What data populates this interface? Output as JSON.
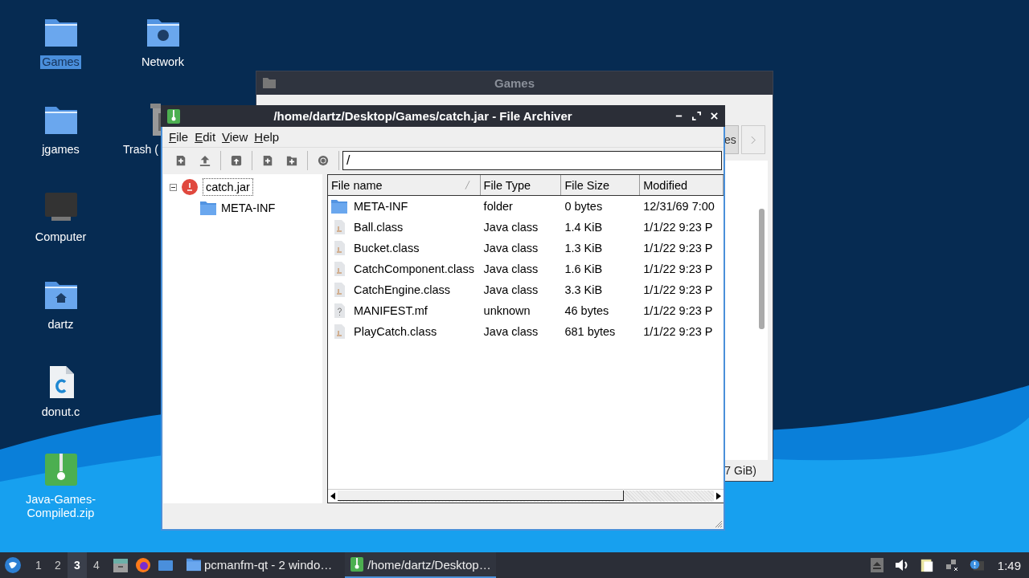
{
  "desktop": {
    "icons": [
      {
        "label": "Games",
        "kind": "folder",
        "selected": true
      },
      {
        "label": "jgames",
        "kind": "folder",
        "selected": false
      },
      {
        "label": "Computer",
        "kind": "computer",
        "selected": false
      },
      {
        "label": "dartz",
        "kind": "home",
        "selected": false
      },
      {
        "label": "donut.c",
        "kind": "c-file",
        "selected": false
      },
      {
        "label": "Java-Games-Compiled.zip",
        "kind": "zip",
        "selected": false
      },
      {
        "label": "Network",
        "kind": "network",
        "selected": false
      },
      {
        "label": "Trash (",
        "kind": "trash",
        "selected": false
      }
    ]
  },
  "back_window": {
    "title": "Games",
    "path_button": "es",
    "status": "7 GiB)"
  },
  "archive_window": {
    "title": "/home/dartz/Desktop/Games/catch.jar - File Archiver",
    "menu": [
      "File",
      "Edit",
      "View",
      "Help"
    ],
    "location": "/",
    "tree": {
      "label": "catch.jar",
      "expanded": true,
      "children": [
        {
          "label": "META-INF"
        }
      ]
    },
    "columns": [
      {
        "label": "File name",
        "sorted": true
      },
      {
        "label": "File Type",
        "sorted": false
      },
      {
        "label": "File Size",
        "sorted": false
      },
      {
        "label": "Modified",
        "sorted": false
      }
    ],
    "rows": [
      {
        "kind": "folder",
        "name": "META-INF",
        "type": "folder",
        "size": "0 bytes",
        "modified": "12/31/69 7:00"
      },
      {
        "kind": "class",
        "name": "Ball.class",
        "type": "Java class",
        "size": "1.4 KiB",
        "modified": "1/1/22 9:23 P"
      },
      {
        "kind": "class",
        "name": "Bucket.class",
        "type": "Java class",
        "size": "1.3 KiB",
        "modified": "1/1/22 9:23 P"
      },
      {
        "kind": "class",
        "name": "CatchComponent.class",
        "type": "Java class",
        "size": "1.6 KiB",
        "modified": "1/1/22 9:23 P"
      },
      {
        "kind": "class",
        "name": "CatchEngine.class",
        "type": "Java class",
        "size": "3.3 KiB",
        "modified": "1/1/22 9:23 P"
      },
      {
        "kind": "unknown",
        "name": "MANIFEST.mf",
        "type": "unknown",
        "size": "46 bytes",
        "modified": "1/1/22 9:23 P"
      },
      {
        "kind": "class",
        "name": "PlayCatch.class",
        "type": "Java class",
        "size": "681 bytes",
        "modified": "1/1/22 9:23 P"
      }
    ]
  },
  "taskbar": {
    "workspaces": [
      {
        "label": "1",
        "selected": false
      },
      {
        "label": "2",
        "selected": false
      },
      {
        "label": "3",
        "selected": true
      },
      {
        "label": "4",
        "selected": false
      }
    ],
    "tasks": [
      {
        "label": "pcmanfm-qt - 2 windo…",
        "kind": "folder",
        "selected": false
      },
      {
        "label": "/home/dartz/Desktop…",
        "kind": "archive",
        "selected": true
      }
    ],
    "clock": "1:49"
  }
}
